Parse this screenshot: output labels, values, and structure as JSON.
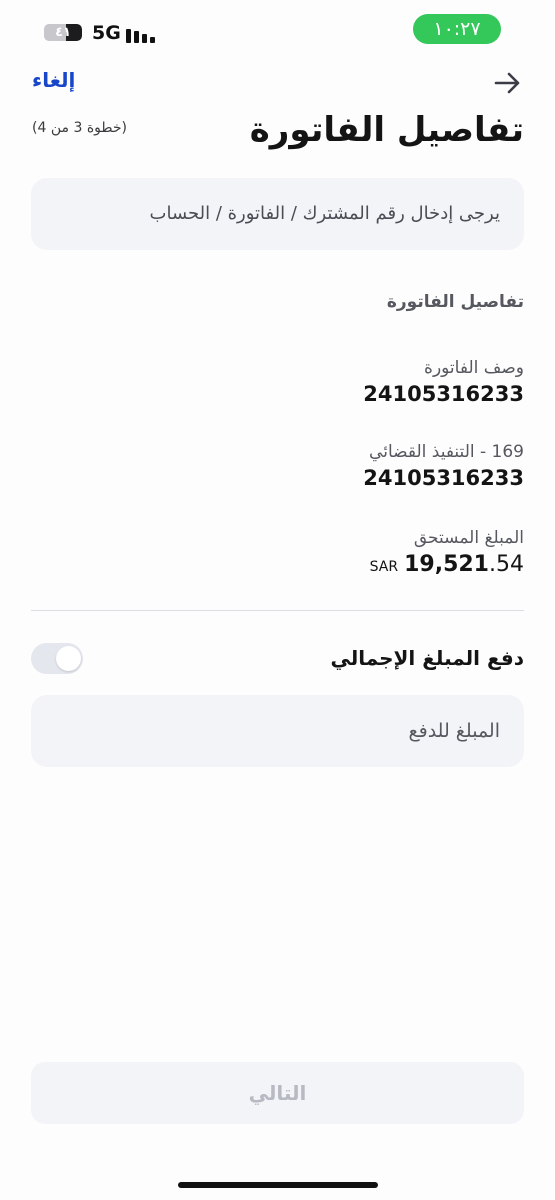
{
  "status_bar": {
    "time": "١٠:٢٧",
    "network": "5G",
    "battery_label": "٤١",
    "battery_level_percent": 41,
    "signal_bars": 4
  },
  "nav": {
    "cancel_label": "إلغاء",
    "back_icon": "arrow-right-icon"
  },
  "header": {
    "title": "تفاصيل الفاتورة",
    "step": "(خطوة 3 من 4)"
  },
  "info": {
    "text": "يرجى إدخال رقم المشترك / الفاتورة / الحساب"
  },
  "details": {
    "section_title": "تفاصيل الفاتورة",
    "fields": [
      {
        "label": "وصف الفاتورة",
        "value": "24105316233"
      },
      {
        "label": "169 - التنفيذ القضائي",
        "value": "24105316233"
      }
    ],
    "amount_due": {
      "label": "المبلغ المستحق",
      "currency": "SAR",
      "integer": "19,521",
      "decimal": ".54"
    }
  },
  "pay_full": {
    "label": "دفع المبلغ الإجمالي",
    "enabled": false
  },
  "amount_input": {
    "placeholder": "المبلغ للدفع",
    "value": ""
  },
  "footer": {
    "next_label": "التالي"
  },
  "colors": {
    "accent": "#1846c8",
    "time_pill": "#34c759",
    "surface": "#f3f4f8",
    "disabled_text": "#b7bac3"
  }
}
